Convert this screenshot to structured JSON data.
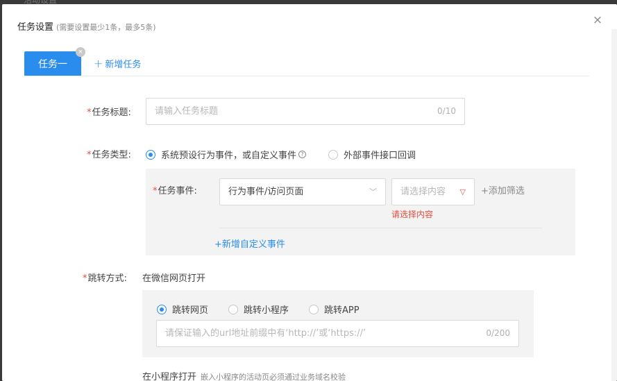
{
  "background_title": "活动设置",
  "dialog": {
    "title": "任务设置",
    "subtitle": "(需要设置最少1条，最多5条)",
    "close": "×"
  },
  "tabs": {
    "items": [
      {
        "label": "任务一",
        "close": "×"
      }
    ],
    "add_label": "新增任务",
    "add_icon": "+"
  },
  "form": {
    "title_field": {
      "label": "任务标题:",
      "placeholder": "请输入任务标题",
      "count": "0/10"
    },
    "type_field": {
      "label": "任务类型:",
      "options": [
        "系统预设行为事件，或自定义事件",
        "外部事件接口回调"
      ],
      "selected": 0,
      "help": "?"
    },
    "event_field": {
      "label": "任务事件:",
      "event_select": "行为事件/访问页面",
      "content_select_placeholder": "请选择内容",
      "add_filter": "添加筛选",
      "add_filter_icon": "+",
      "error": "请选择内容",
      "add_custom": "+新增自定义事件"
    },
    "jump_field": {
      "label": "跳转方式:",
      "wechat_label": "在微信网页打开",
      "options": [
        "跳转网页",
        "跳转小程序",
        "跳转APP"
      ],
      "selected": 0,
      "url_placeholder": "请保证输入的url地址前缀中有‘http://’或‘https://’",
      "url_count": "0/200",
      "mini_label": "在小程序打开",
      "mini_hint": "嵌入小程序的活动页必须通过业务域名校验"
    }
  },
  "colors": {
    "primary": "#2a8dee",
    "required": "#e74c3c",
    "panel_bg": "#f3f3f3"
  }
}
